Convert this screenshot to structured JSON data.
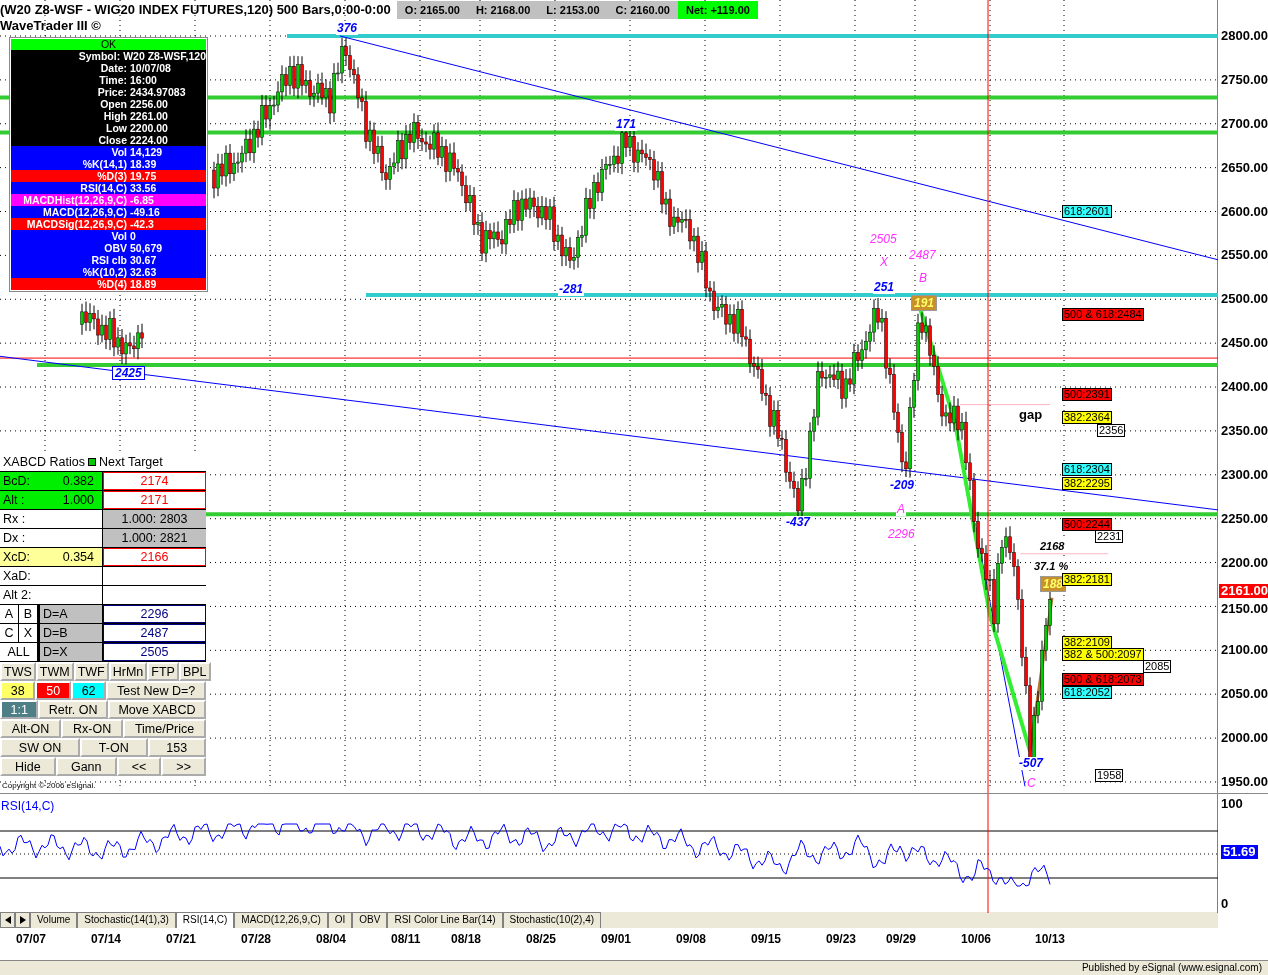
{
  "header": {
    "title": "(W20 Z8-WSF - WIG20 INDEX FUTURES,120) 500 Bars,0:00-0:00",
    "quotes": [
      "O: 2165.00",
      "H: 2168.00",
      "L: 2153.00",
      "C: 2160.00"
    ],
    "net": "Net: +119.00",
    "subtitle": "WaveTrader III ©"
  },
  "info_panel": {
    "status": "OK",
    "rows": [
      {
        "label": "Symbol:",
        "value": "W20 Z8-WSF,120",
        "color": "#000000"
      },
      {
        "label": "Date:",
        "value": "10/07/08",
        "color": "#000000"
      },
      {
        "label": "Time:",
        "value": "16:00",
        "color": "#000000"
      },
      {
        "label": "Price:",
        "value": "2434.97083",
        "color": "#000000"
      },
      {
        "label": "Open",
        "value": "2256.00",
        "color": "#000000"
      },
      {
        "label": "High",
        "value": "2261.00",
        "color": "#000000"
      },
      {
        "label": "Low",
        "value": "2200.00",
        "color": "#000000"
      },
      {
        "label": "Close",
        "value": "2224.00",
        "color": "#000000"
      },
      {
        "label": "Vol",
        "value": "14,129",
        "color": "#0000ff"
      },
      {
        "label": "%K(14,1)",
        "value": "18.39",
        "color": "#0000ff"
      },
      {
        "label": "%D(3)",
        "value": "19.75",
        "color": "#ff0000"
      },
      {
        "label": "RSI(14,C)",
        "value": "33.56",
        "color": "#0000ff"
      },
      {
        "label": "MACDHist(12,26,9,C)",
        "value": "-6.85",
        "color": "#ff00ff"
      },
      {
        "label": "MACD(12,26,9,C)",
        "value": "-49.16",
        "color": "#0000ff"
      },
      {
        "label": "MACDSig(12,26,9,C)",
        "value": "-42.3",
        "color": "#ff0000"
      },
      {
        "label": "Vol",
        "value": "0",
        "color": "#0000ff"
      },
      {
        "label": "OBV",
        "value": "50,679",
        "color": "#0000ff"
      },
      {
        "label": "RSI clb",
        "value": "30.67",
        "color": "#0000ff"
      },
      {
        "label": "%K(10,2)",
        "value": "32.63",
        "color": "#0000ff"
      },
      {
        "label": "%D(4)",
        "value": "18.89",
        "color": "#ff0000"
      }
    ]
  },
  "price_axis": {
    "ticks": [
      "2800.00",
      "2750.00",
      "2700.00",
      "2650.00",
      "2600.00",
      "2550.00",
      "2500.00",
      "2450.00",
      "2400.00",
      "2350.00",
      "2300.00",
      "2250.00",
      "2200.00",
      "2150.00",
      "2100.00",
      "2050.00",
      "2000.00",
      "1950.00"
    ],
    "last_price": "2161.00"
  },
  "wave_labels": [
    {
      "text": "376",
      "kind": "count"
    },
    {
      "text": "171",
      "kind": "count"
    },
    {
      "text": "2505",
      "kind": "pattern"
    },
    {
      "text": "2487",
      "kind": "pattern"
    },
    {
      "text": "X",
      "kind": "pattern"
    },
    {
      "text": "B",
      "kind": "pattern"
    },
    {
      "text": "-281",
      "kind": "count"
    },
    {
      "text": "251",
      "kind": "count"
    },
    {
      "text": "191",
      "kind": "bars"
    },
    {
      "text": "2425",
      "kind": "boxed"
    },
    {
      "text": "gap",
      "kind": "note"
    },
    {
      "text": "-209",
      "kind": "count"
    },
    {
      "text": "A",
      "kind": "pattern"
    },
    {
      "text": "-437",
      "kind": "count"
    },
    {
      "text": "2296",
      "kind": "pattern"
    },
    {
      "text": "2168",
      "kind": "level"
    },
    {
      "text": "37.1 %",
      "kind": "level"
    },
    {
      "text": "188",
      "kind": "bars"
    },
    {
      "text": "-507",
      "kind": "count"
    },
    {
      "text": "C",
      "kind": "pattern"
    }
  ],
  "fib_labels": [
    {
      "text": "618:2601",
      "color": "#33ffff"
    },
    {
      "text": "500 & 618:2484",
      "color": "#ff0000"
    },
    {
      "text": "500:2391",
      "color": "#ff0000"
    },
    {
      "text": "382:2364",
      "color": "#ffff00"
    },
    {
      "text": "2356",
      "color": "#ffffff"
    },
    {
      "text": "618:2304",
      "color": "#33ffff"
    },
    {
      "text": "382:2295",
      "color": "#ffff00"
    },
    {
      "text": "500:2244",
      "color": "#ff0000"
    },
    {
      "text": "2231",
      "color": "#ffffff"
    },
    {
      "text": "382:2181",
      "color": "#ffff00"
    },
    {
      "text": "382:2109",
      "color": "#ffff00"
    },
    {
      "text": "382 & 500:2097",
      "color": "#ffff00"
    },
    {
      "text": "2085",
      "color": "#ffffff"
    },
    {
      "text": "500 & 618:2073",
      "color": "#ff0000"
    },
    {
      "text": "618:2052",
      "color": "#33ffff"
    },
    {
      "text": "1958",
      "color": "#ffffff"
    }
  ],
  "xabcd_panel": {
    "title": "XABCD Ratios",
    "target_title": "Next Target",
    "ratios": [
      {
        "label": "BcD:",
        "value": "0.382",
        "target": "2174",
        "kind": "hit"
      },
      {
        "label": "Alt  :",
        "value": "1.000",
        "target": "2171",
        "kind": "hit"
      },
      {
        "label": "Rx  :",
        "target": "1.000: 2803",
        "kind": "ext"
      },
      {
        "label": "Dx  :",
        "target": "1.000: 2821",
        "kind": "ext"
      },
      {
        "label": "XcD:",
        "value": "0.354",
        "target": "2166",
        "kind": "near"
      },
      {
        "label": "XaD:",
        "kind": "empty"
      },
      {
        "label": "Alt 2:",
        "kind": "empty"
      }
    ],
    "points": [
      {
        "keys": [
          "A",
          "B"
        ],
        "label": "D=A",
        "value": "2296"
      },
      {
        "keys": [
          "C",
          "X"
        ],
        "label": "D=B",
        "value": "2487"
      },
      {
        "keys": [
          "ALL"
        ],
        "label": "D=X",
        "value": "2505"
      }
    ],
    "buttons": [
      [
        {
          "label": "TWS"
        },
        {
          "label": "TWM"
        },
        {
          "label": "TWF"
        },
        {
          "label": "HrMn"
        },
        {
          "label": "FTP"
        },
        {
          "label": "BPL"
        }
      ],
      [
        {
          "label": "38",
          "color": "#ffff66"
        },
        {
          "label": "50",
          "color": "#ff0000"
        },
        {
          "label": "62",
          "color": "#00ffff"
        },
        {
          "label": "Test New D=?"
        }
      ],
      [
        {
          "label": "1:1",
          "color": "#4f7f86"
        },
        {
          "label": "Retr. ON"
        },
        {
          "label": "Move XABCD"
        }
      ],
      [
        {
          "label": "Alt-ON"
        },
        {
          "label": "Rx-ON"
        },
        {
          "label": "Time/Price"
        }
      ],
      [
        {
          "label": "SW ON"
        },
        {
          "label": "T-ON"
        },
        {
          "label": "153"
        }
      ],
      [
        {
          "label": "Hide"
        },
        {
          "label": "Gann"
        },
        {
          "label": "<<"
        },
        {
          "label": ">>"
        }
      ]
    ],
    "copyright": "Copyright © 2006 eSignal."
  },
  "rsi_panel": {
    "title": "RSI(14,C)",
    "ticks": [
      "100",
      "0"
    ],
    "value": "51.69"
  },
  "tabs": [
    {
      "label": "Volume",
      "selected": false
    },
    {
      "label": "Stochastic(14(1),3)",
      "selected": false
    },
    {
      "label": "RSI(14,C)",
      "selected": true
    },
    {
      "label": "MACD(12,26,9,C)",
      "selected": false
    },
    {
      "label": "OI",
      "selected": false
    },
    {
      "label": "OBV",
      "selected": false
    },
    {
      "label": "RSI Color Line Bar(14)",
      "selected": false
    },
    {
      "label": "Stochastic(10(2),4)",
      "selected": false
    }
  ],
  "dates": [
    "07/07",
    "07/14",
    "07/21",
    "07/28",
    "08/04",
    "08/11",
    "08/18",
    "08/25",
    "09/01",
    "09/08",
    "09/15",
    "09/23",
    "09/29",
    "10/06",
    "10/13"
  ],
  "footer": "Published by eSignal (www.esignal.com)"
}
